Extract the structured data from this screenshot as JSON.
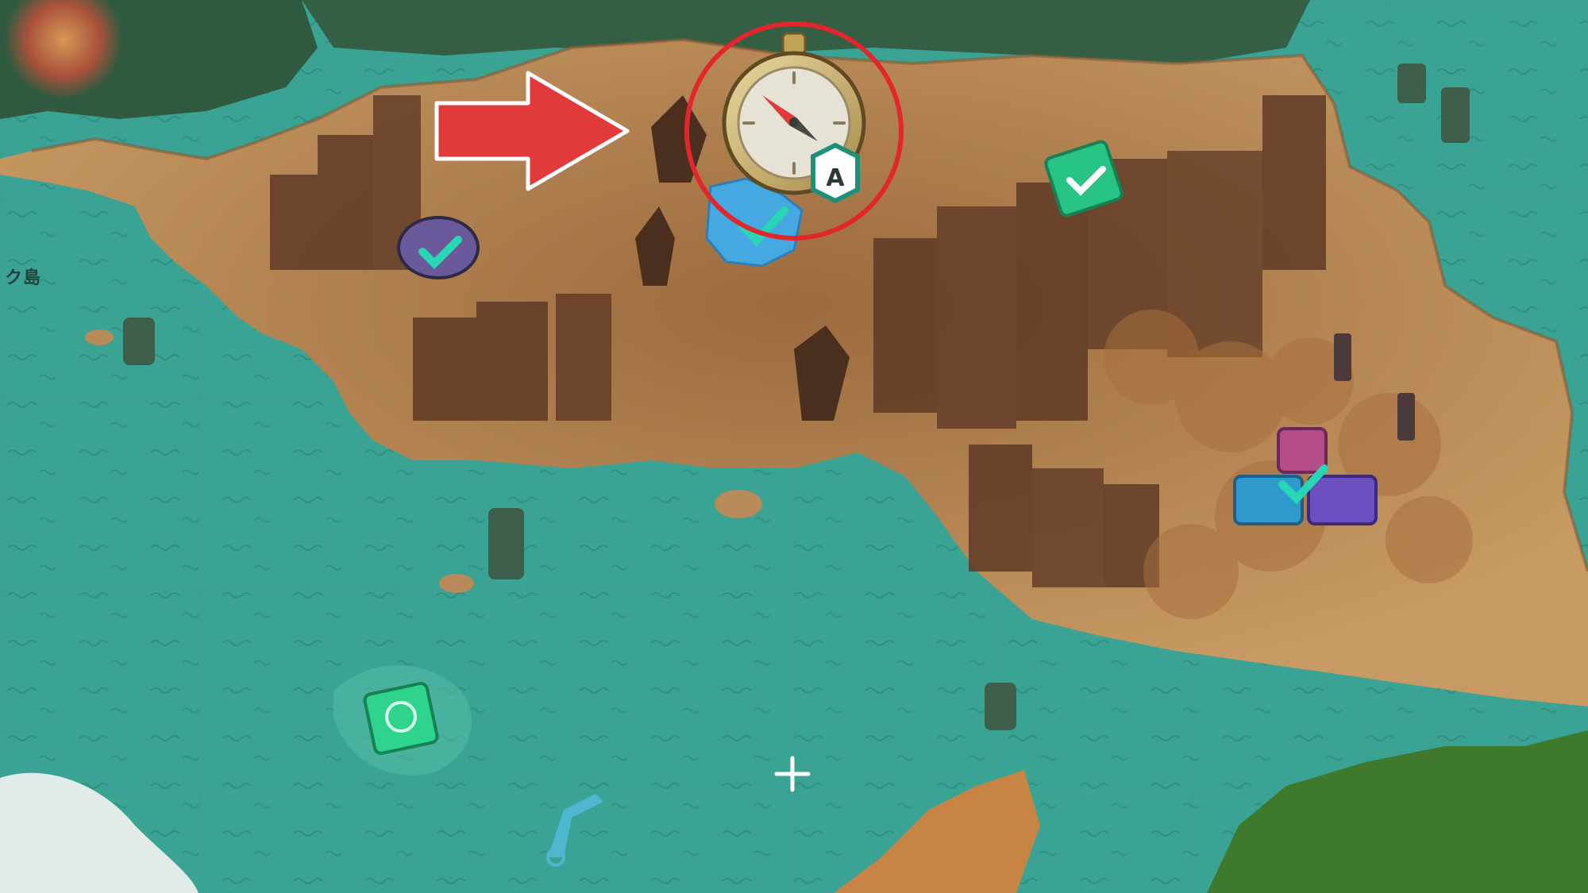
{
  "map": {
    "region_label": "ク島",
    "compass": {
      "key_hint": "A"
    }
  },
  "colors": {
    "sea": "#3aa394",
    "sea_light": "#52b3a2",
    "land": "#b98a5a",
    "land_dark": "#7a4a2c",
    "rock": "#5e3a26",
    "forest": "#3f7a2c",
    "highlight_circle": "#e1262c",
    "arrow": "#e23a3a",
    "quest_book": "#27c486",
    "checkmark": "#28d6b4"
  },
  "markers": [
    {
      "name": "bottle-quest",
      "status": "completed"
    },
    {
      "name": "water-source-quest",
      "status": "completed"
    },
    {
      "name": "journal-quest-north",
      "status": "completed"
    },
    {
      "name": "treasure-chest-quest",
      "status": "completed"
    },
    {
      "name": "journal-quest-south",
      "status": "available"
    }
  ],
  "icons": [
    "compass-icon",
    "arrow-icon",
    "checkmark-icon",
    "book-icon",
    "chest-icon",
    "crosshair-icon",
    "crane-icon",
    "pipe-icon"
  ]
}
